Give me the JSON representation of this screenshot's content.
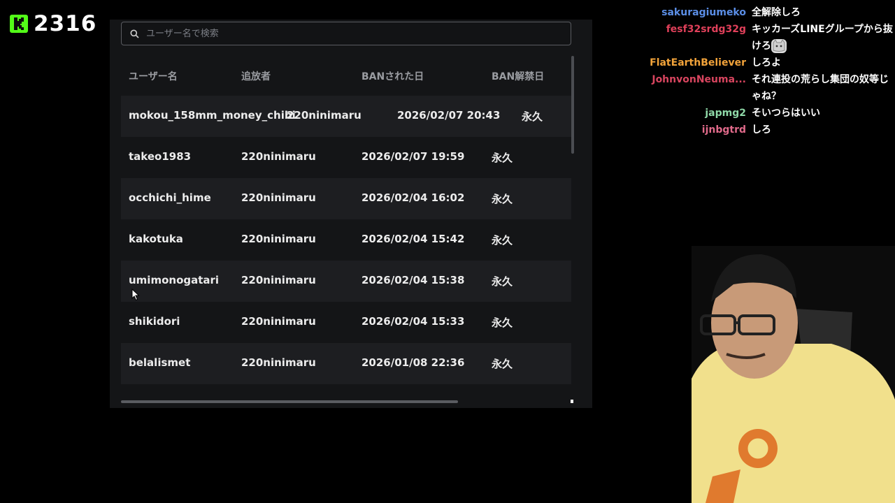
{
  "overlay": {
    "viewer_count": "2316"
  },
  "search": {
    "placeholder": "ユーザー名で検索"
  },
  "table": {
    "headers": [
      "ユーザー名",
      "追放者",
      "BANされた日",
      "BAN解禁日"
    ],
    "rows": [
      [
        "mokou_158mm_money_chibi",
        "220ninimaru",
        "2026/02/07 20:43",
        "永久"
      ],
      [
        "takeo1983",
        "220ninimaru",
        "2026/02/07 19:59",
        "永久"
      ],
      [
        "occhichi_hime",
        "220ninimaru",
        "2026/02/04 16:02",
        "永久"
      ],
      [
        "kakotuka",
        "220ninimaru",
        "2026/02/04 15:42",
        "永久"
      ],
      [
        "umimonogatari",
        "220ninimaru",
        "2026/02/04 15:38",
        "永久"
      ],
      [
        "shikidori",
        "220ninimaru",
        "2026/02/04 15:33",
        "永久"
      ],
      [
        "belalismet",
        "220ninimaru",
        "2026/01/08 22:36",
        "永久"
      ]
    ]
  },
  "chat": [
    {
      "user": "sakuragiumeko",
      "color": "#5b8ee6",
      "text": "全解除しろ"
    },
    {
      "user": "fesf32srdg32g",
      "color": "#e0405a",
      "text": "キッカーズLINEグループから抜けろ"
    },
    {
      "user": "FlatEarthBeliever",
      "color": "#f2a33a",
      "text": "しろよ"
    },
    {
      "user": "JohnvonNeuma...",
      "color": "#d8455f",
      "text": "それ連投の荒らし集団の奴等じゃね？"
    },
    {
      "user": "japmg2",
      "color": "#8fd9a8",
      "text": "そいつらはいい"
    },
    {
      "user": "ijnbgtrd",
      "color": "#e06a8a",
      "text": "しろ"
    }
  ],
  "colors": {
    "kick_green": "#53fc18",
    "panel_bg": "#141517",
    "row_alt_bg": "#1d1e21"
  }
}
